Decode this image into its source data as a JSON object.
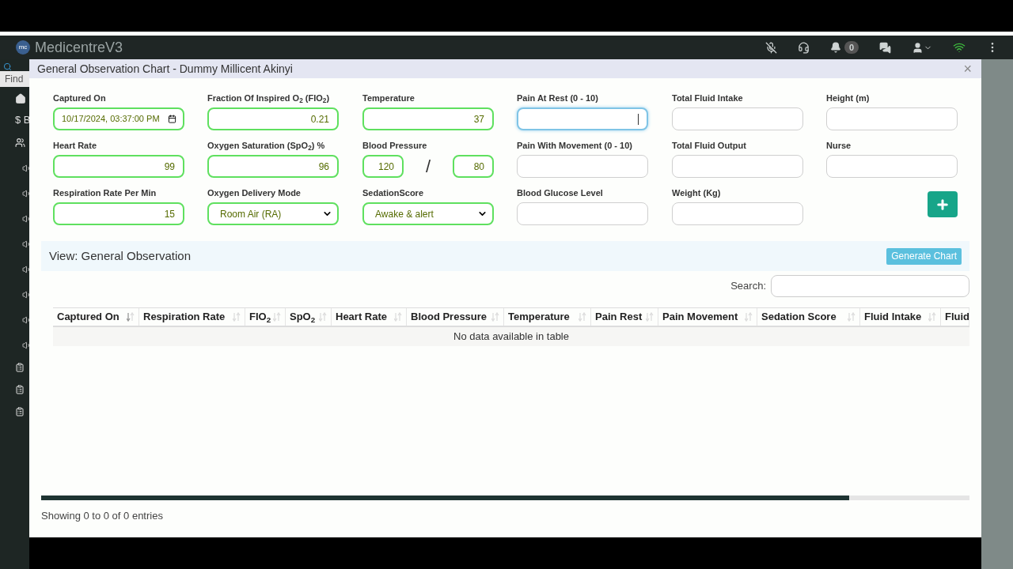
{
  "app": {
    "brand": "MedicentreV3",
    "logo": "mc",
    "notifications": "0",
    "find_placeholder": "Find",
    "sidebar_label": "$ B"
  },
  "modal": {
    "title": "General Observation Chart - Dummy Millicent Akinyi",
    "close": "×"
  },
  "fields": [
    {
      "label": "Captured On",
      "kind": "date",
      "value": "10/17/2024, 03:37:00 PM",
      "valid": true,
      "focused": false
    },
    {
      "label": "Fraction Of Inspired O$_{2}$ (FIO$_{2}$)",
      "kind": "input",
      "value": "0.21",
      "valid": true,
      "focused": false
    },
    {
      "label": "Temperature",
      "kind": "input",
      "value": "37",
      "valid": true,
      "focused": false
    },
    {
      "label": "Pain At Rest (0 - 10)",
      "kind": "input",
      "focused": true
    },
    {
      "label": "Total Fluid Intake",
      "kind": "input",
      "valid": false,
      "focused": false
    },
    {
      "label": "Height (m)",
      "kind": "input",
      "valid": false,
      "focused": false
    },
    {
      "label": "Heart Rate",
      "kind": "input",
      "value": "99",
      "valid": true,
      "focused": false
    },
    {
      "label": "Oxygen Saturation (SpO$_{2}$) %",
      "kind": "input",
      "value": "96",
      "valid": true,
      "focused": false
    },
    {
      "label": "Blood Pressure",
      "kind": "pair",
      "value": "120",
      "value2": "80",
      "separator": "/",
      "valid": true,
      "focused": false
    },
    {
      "label": "Pain With Movement (0 - 10)",
      "kind": "input",
      "valid": false,
      "focused": false
    },
    {
      "label": "Total Fluid Output",
      "kind": "input",
      "valid": false,
      "focused": false
    },
    {
      "label": "Nurse",
      "kind": "input",
      "valid": false,
      "focused": false
    },
    {
      "label": "Respiration Rate Per Min",
      "kind": "input",
      "value": "15",
      "valid": true,
      "focused": false
    },
    {
      "label": "Oxygen Delivery Mode",
      "kind": "select",
      "value": "Room Air (RA)",
      "valid": true,
      "focused": false
    },
    {
      "label": "SedationScore",
      "kind": "select",
      "value": "Awake & alert",
      "valid": true,
      "focused": false
    },
    {
      "label": "Blood Glucose Level",
      "kind": "input",
      "valid": false,
      "focused": false
    },
    {
      "label": "Weight (Kg)",
      "kind": "input",
      "valid": false,
      "focused": false
    },
    {
      "kind": "add"
    }
  ],
  "view": {
    "title": "View: General Observation",
    "generate_button": "Generate Chart",
    "search_label": "Search:"
  },
  "table": {
    "columns": [
      {
        "label": "Captured On",
        "sorted": true
      },
      {
        "label": "Respiration Rate",
        "sorted": false
      },
      {
        "label": "FIO$_{2}$",
        "sorted": false
      },
      {
        "label": "SpO$_{2}$",
        "sorted": false
      },
      {
        "label": "Heart Rate",
        "sorted": false
      },
      {
        "label": "Blood Pressure",
        "sorted": false
      },
      {
        "label": "Temperature",
        "sorted": false
      },
      {
        "label": "Pain Rest",
        "sorted": false
      },
      {
        "label": "Pain Movement",
        "sorted": false
      },
      {
        "label": "Sedation Score",
        "sorted": false
      },
      {
        "label": "Fluid Intake",
        "sorted": false
      },
      {
        "label": "Fluid"
      }
    ],
    "empty_message": "No data available in table",
    "info": "Showing 0 to 0 of 0 entries"
  }
}
